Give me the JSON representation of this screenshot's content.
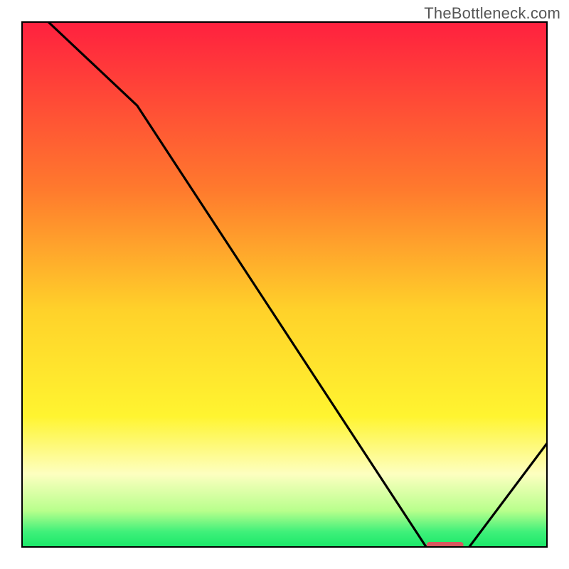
{
  "watermark": "TheBottleneck.com",
  "chart_data": {
    "type": "line",
    "title": "",
    "xlabel": "",
    "ylabel": "",
    "xlim": [
      0,
      100
    ],
    "ylim": [
      0,
      100
    ],
    "grid": false,
    "legend": false,
    "x": [
      0,
      5,
      22,
      77,
      85,
      100
    ],
    "values": [
      102,
      100,
      84,
      0,
      0,
      20
    ],
    "gradient_stops": [
      {
        "pct": 0,
        "color": "#ff203f"
      },
      {
        "pct": 32,
        "color": "#ff7a2d"
      },
      {
        "pct": 55,
        "color": "#ffd22a"
      },
      {
        "pct": 75,
        "color": "#fff430"
      },
      {
        "pct": 86,
        "color": "#fdffc0"
      },
      {
        "pct": 93,
        "color": "#b8ff8c"
      },
      {
        "pct": 97,
        "color": "#3ff07a"
      },
      {
        "pct": 100,
        "color": "#18e868"
      }
    ],
    "marker_band": {
      "x_start": 77,
      "x_end": 84,
      "color": "#d9575f"
    }
  }
}
